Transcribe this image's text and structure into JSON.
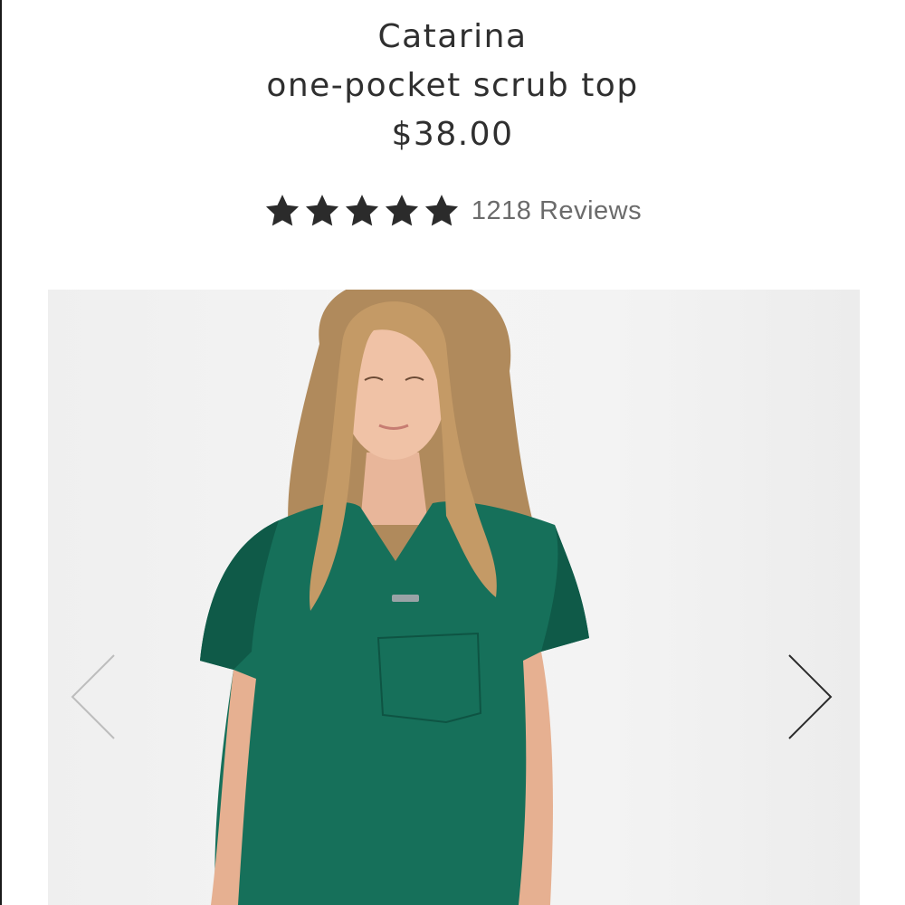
{
  "product": {
    "name_line1": "Catarina",
    "name_line2": "one-pocket scrub top",
    "price": "$38.00"
  },
  "rating": {
    "stars": 5,
    "max_stars": 5,
    "reviews_label": "1218 Reviews"
  },
  "gallery": {
    "prev_icon": "chevron-left-icon",
    "next_icon": "chevron-right-icon"
  },
  "colors": {
    "scrub_green": "#16705a",
    "star": "#2b2b2b",
    "text": "#2f2f2f",
    "muted_text": "#6b6b6b",
    "background": "#ffffff",
    "photo_background": "#f2f2f2"
  }
}
